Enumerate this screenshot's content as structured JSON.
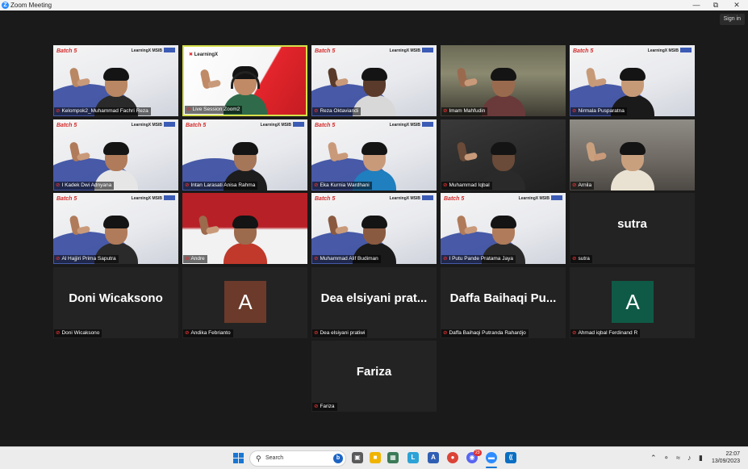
{
  "window": {
    "title": "Zoom Meeting",
    "controls": [
      "minimize",
      "restore",
      "close"
    ],
    "sign_in": "Sign in"
  },
  "participants": [
    {
      "name": "Kelompok2_Muhammad Fachri Reza",
      "type": "video",
      "bg": "batch",
      "skin": "#b98763",
      "shirt": "#2a2a2a",
      "hand": true
    },
    {
      "name": "Live Session Zoom2",
      "type": "video",
      "bg": "learningx",
      "skin": "#c08a66",
      "shirt": "#2f6b4a",
      "hand": true,
      "active": true,
      "headset": true
    },
    {
      "name": "Reza Oktaviandi",
      "type": "video",
      "bg": "batch",
      "skin": "#5a3a2a",
      "shirt": "#d8d8d8",
      "hand": true
    },
    {
      "name": "Imam Mahfudin",
      "type": "video",
      "bg": "shelf",
      "skin": "#9a6a4f",
      "shirt": "#6a3a3a",
      "hand": true
    },
    {
      "name": "Nirmala Pusparatna",
      "type": "video",
      "bg": "batch",
      "skin": "#c79a77",
      "shirt": "#1a1a1a",
      "hand": true
    },
    {
      "name": "I Kadek Dwi Adnyana",
      "type": "video",
      "bg": "batch",
      "skin": "#b07b5a",
      "shirt": "#e6e6e6",
      "hand": true
    },
    {
      "name": "Intan Larasati Anisa Rahma",
      "type": "video",
      "bg": "batch",
      "skin": "#a57658",
      "shirt": "#1d1d1d",
      "hand": false
    },
    {
      "name": "Eka Kurnia Wardhani",
      "type": "video",
      "bg": "batch",
      "skin": "#c99a7a",
      "shirt": "#1f7fbf",
      "hand": true
    },
    {
      "name": "Muhammad Iqbal",
      "type": "video",
      "bg": "dark",
      "skin": "#6a4a38",
      "shirt": "#2a2a2a",
      "hand": true
    },
    {
      "name": "Arnila",
      "type": "video",
      "bg": "room",
      "skin": "#c9a07e",
      "shirt": "#e9e2d2",
      "hand": true
    },
    {
      "name": "Al Hajjiri Prima Saputra",
      "type": "video",
      "bg": "batch",
      "skin": "#b07b5a",
      "shirt": "#2a2a2a",
      "hand": true
    },
    {
      "name": "Andre",
      "type": "video",
      "bg": "red",
      "skin": "#9c6a4c",
      "shirt": "#c0392b",
      "hand": true
    },
    {
      "name": "Muhammad Alif Budiman",
      "type": "video",
      "bg": "batch",
      "skin": "#8a5a40",
      "shirt": "#1a1a1a",
      "hand": true
    },
    {
      "name": "I Putu Pande Pratama Jaya",
      "type": "video",
      "bg": "batch",
      "skin": "#b07b5a",
      "shirt": "#2a2a2a",
      "hand": true
    },
    {
      "name": "sutra",
      "type": "name",
      "display": "sutra"
    },
    {
      "name": "Doni Wicaksono",
      "type": "name",
      "display": "Doni Wicaksono"
    },
    {
      "name": "Andika Febrianto",
      "type": "avatar",
      "initial": "A",
      "color": "#6b3a2a"
    },
    {
      "name": "Dea elsiyani pratiwi",
      "type": "name",
      "display": "Dea elsiyani prat..."
    },
    {
      "name": "Daffa Baihaqi Putranda Rahardjo",
      "type": "name",
      "display": "Daffa Baihaqi Pu..."
    },
    {
      "name": "Ahmad iqbal Ferdinand R",
      "type": "avatar",
      "initial": "A",
      "color": "#0f5a46"
    },
    {
      "name": "Fariza",
      "type": "name",
      "display": "Fariza"
    }
  ],
  "branding": {
    "batch": "Batch 5",
    "learningx": "LearningX",
    "msib": "MSIB"
  },
  "taskbar": {
    "search_placeholder": "Search",
    "apps": [
      "task-view",
      "widgets",
      "file-explorer",
      "store",
      "learningx-app",
      "app-a",
      "chrome",
      "discord",
      "zoom",
      "vscode"
    ],
    "badge": "23",
    "tray": [
      "chevron-up",
      "mic",
      "wifi",
      "volume",
      "battery"
    ]
  },
  "clock": {
    "time": "22:07",
    "date": "13/09/2023"
  }
}
